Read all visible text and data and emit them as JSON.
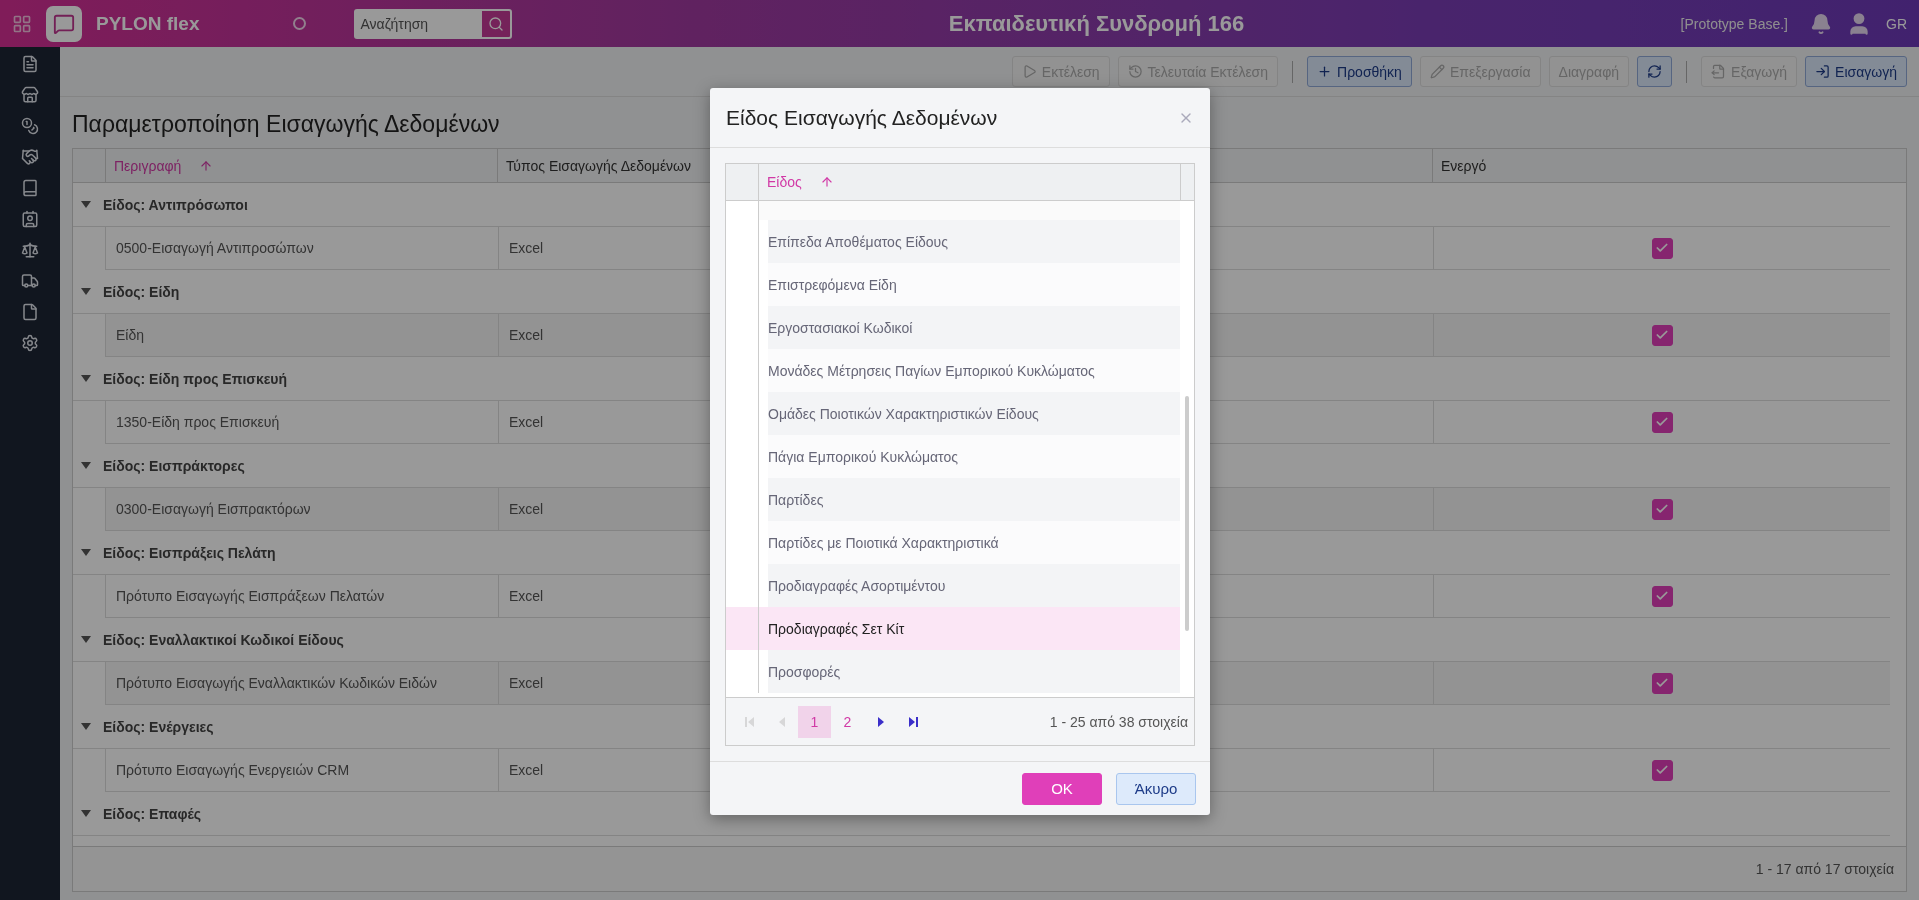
{
  "app": {
    "brand": "PYLON flex",
    "search": {
      "placeholder": "Αναζήτηση"
    },
    "title": "Εκπαιδευτική Συνδρομή 166",
    "environment": "[Prototype Base.]",
    "language": "GR"
  },
  "toolbar": {
    "groups": [
      {
        "buttons": [
          {
            "label": "Εκτέλεση",
            "disabled": true
          },
          {
            "label": "Τελευταία Εκτέλεση",
            "disabled": true
          }
        ]
      },
      {
        "buttons": [
          {
            "label": "Προσθήκη",
            "disabled": false
          },
          {
            "label": "Επεξεργασία",
            "disabled": true
          },
          {
            "label": "Διαγραφή",
            "disabled": true
          },
          {
            "disabled": false
          }
        ]
      },
      {
        "buttons": [
          {
            "label": "Εξαγωγή",
            "disabled": true
          },
          {
            "label": "Εισαγωγή",
            "disabled": false
          }
        ]
      }
    ]
  },
  "page_title": "Παραμετροποίηση Εισαγωγής Δεδομένων",
  "table": {
    "columns": [
      {
        "label": "Περιγραφή",
        "sorted": true
      },
      {
        "label": "Τύπος Εισαγωγής Δεδομένων",
        "sorted": false
      },
      {
        "label": "Ενεργό",
        "sorted": false
      }
    ],
    "groups": [
      {
        "label": "Είδος: Αντιπρόσωποι",
        "expanded": true,
        "rows": [
          {
            "description": "0500-Εισαγωγή Αντιπροσώπων",
            "type": "Excel",
            "active": true
          }
        ]
      },
      {
        "label": "Είδος: Είδη",
        "expanded": true,
        "rows": [
          {
            "description": "Είδη",
            "type": "Excel",
            "active": true
          }
        ]
      },
      {
        "label": "Είδος: Είδη προς Επισκευή",
        "expanded": true,
        "rows": [
          {
            "description": "1350-Είδη προς Επισκευή",
            "type": "Excel",
            "active": true
          }
        ]
      },
      {
        "label": "Είδος: Εισπράκτορες",
        "expanded": true,
        "rows": [
          {
            "description": "0300-Εισαγωγή Εισπρακτόρων",
            "type": "Excel",
            "active": true
          }
        ]
      },
      {
        "label": "Είδος: Εισπράξεις Πελάτη",
        "expanded": true,
        "rows": [
          {
            "description": "Πρότυπο Εισαγωγής Εισπράξεων Πελατών",
            "type": "Excel",
            "active": true
          }
        ]
      },
      {
        "label": "Είδος: Εναλλακτικοί Κωδικοί Είδους",
        "expanded": true,
        "rows": [
          {
            "description": "Πρότυπο Εισαγωγής Εναλλακτικών Κωδικών Ειδών",
            "type": "Excel",
            "active": true
          }
        ]
      },
      {
        "label": "Είδος: Ενέργειες",
        "expanded": true,
        "rows": [
          {
            "description": "Πρότυπο Εισαγωγής Ενεργειών CRM",
            "type": "Excel",
            "active": true
          }
        ]
      },
      {
        "label": "Είδος: Επαφές",
        "expanded": true
      }
    ],
    "footer": "1 - 17 από 17 στοιχεία"
  },
  "dialog": {
    "title": "Είδος Εισαγωγής Δεδομένων",
    "column": {
      "label": "Είδος",
      "sorted": true
    },
    "items": [
      {
        "label": "Επίπεδα Αποθέματος Είδους",
        "selected": false
      },
      {
        "label": "Επιστρεφόμενα Είδη",
        "selected": false
      },
      {
        "label": "Εργοστασιακοί Κωδικοί",
        "selected": false
      },
      {
        "label": "Μονάδες Μέτρησεις Παγίων Εμπορικού Κυκλώματος",
        "selected": false
      },
      {
        "label": "Ομάδες Ποιοτικών Χαρακτηριστικών Είδους",
        "selected": false
      },
      {
        "label": "Πάγια Εμπορικού Κυκλώματος",
        "selected": false
      },
      {
        "label": "Παρτίδες",
        "selected": false
      },
      {
        "label": "Παρτίδες με Ποιοτικά Χαρακτηριστικά",
        "selected": false
      },
      {
        "label": "Προδιαγραφές Ασορτιμέντου",
        "selected": false
      },
      {
        "label": "Προδιαγραφές Σετ Κίτ",
        "selected": true
      },
      {
        "label": "Προσφορές",
        "selected": false
      }
    ],
    "pager": {
      "nav": [
        {
          "kind": "first",
          "disabled": true
        },
        {
          "kind": "prev",
          "disabled": true
        },
        {
          "kind": "next",
          "disabled": false
        },
        {
          "kind": "last",
          "disabled": false
        }
      ],
      "pages": [
        {
          "label": "1",
          "selected": true
        },
        {
          "label": "2",
          "selected": false
        }
      ],
      "summary": "1 - 25 από 38 στοιχεία"
    },
    "buttons": [
      {
        "label": "OK",
        "kind": "primary"
      },
      {
        "label": "Άκυρο",
        "kind": "secondary"
      }
    ]
  }
}
